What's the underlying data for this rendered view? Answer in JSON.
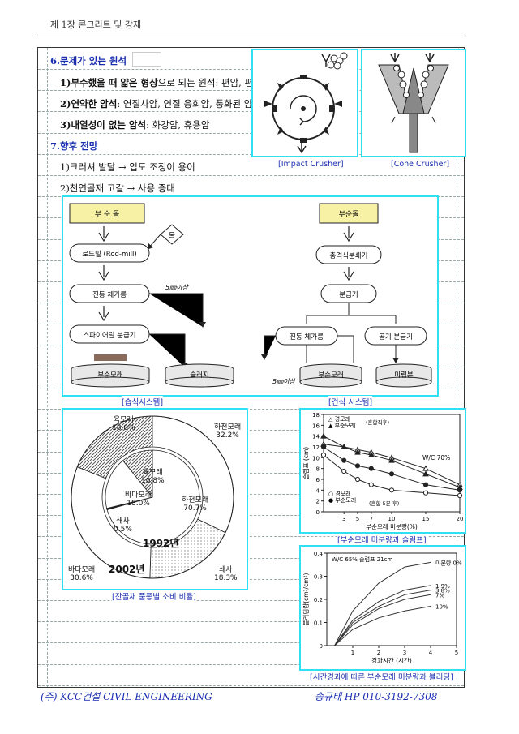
{
  "header": {
    "title": "제 1장 콘크리트 및 강재"
  },
  "section6": {
    "heading": "6.문제가 있는 원석",
    "items": [
      {
        "key": "1)부수했을 때 얇은 형상",
        "rest": "으로 되는 원석: 편암, 편마암"
      },
      {
        "key": "2)연약한 암석",
        "rest": ": 연질사암, 연질 응회암, 풍화된 암석"
      },
      {
        "key": "3)내열성이 없는 암석",
        "rest": ": 화강암, 휴용암"
      }
    ]
  },
  "section7": {
    "heading": "7.향후 전망",
    "items": [
      "1)크러셔 발달 → 입도 조정이 용이",
      "2)천연골재 고갈 → 사용 증대"
    ]
  },
  "crushers": {
    "impact_label": "[Impact Crusher]",
    "cone_label": "[Cone Crusher]"
  },
  "wet_system": {
    "top": "부 순 돌",
    "water": "물",
    "rodmill": "로드밀 (Rod-mill)",
    "screen": "진동 체가름",
    "note": "5㎜이상",
    "spiral": "스파이어럴 분급기",
    "product": "부순모래",
    "sludge": "슬러지",
    "caption": "[습식시스템]"
  },
  "dry_system": {
    "top": "부순돌",
    "impact": "충격식분쇄기",
    "classifier": "분급기",
    "screen": "진동 체가름",
    "air": "공기 분급기",
    "note": "5㎜이상",
    "product": "부순모래",
    "fines": "미립분",
    "caption": "[건식 시스템]"
  },
  "donut": {
    "caption": "[잔골재 품종별 소비 비율]",
    "year_inner": "1992년",
    "year_outer": "2002년",
    "outer_labels": [
      {
        "name": "육모래",
        "pct": "18.8%"
      },
      {
        "name": "하천모래",
        "pct": "32.2%"
      },
      {
        "name": "쇄사",
        "pct": "18.3%"
      },
      {
        "name": "바다모래",
        "pct": "30.6%"
      }
    ],
    "inner_labels": [
      {
        "name": "육모래",
        "pct": "10.8%"
      },
      {
        "name": "바다모래",
        "pct": "18.0%"
      },
      {
        "name": "하천모래",
        "pct": "70.7%"
      },
      {
        "name": "쇄사",
        "pct": "0.5%"
      }
    ]
  },
  "chart_data": [
    {
      "type": "line",
      "caption": "[부순모래 미분량과 슬럼프]",
      "xlabel": "부순모래 미분량(%)",
      "ylabel": "슬럼프 (cm)",
      "xlim": [
        0,
        20
      ],
      "ylim": [
        0,
        18
      ],
      "xticks": [
        3,
        5,
        7,
        10,
        15,
        20
      ],
      "yticks": [
        0,
        2,
        4,
        6,
        8,
        10,
        12,
        14,
        16,
        18
      ],
      "annotation": "W/C 70%",
      "legend_top": [
        "△ 경모래",
        "▲ 부순모래",
        "(혼합직후)"
      ],
      "legend_bottom": [
        "○ 경모래",
        "● 부순모래",
        "(혼합 5분 후)"
      ],
      "series": [
        {
          "marker": "open-triangle",
          "x": [
            0,
            3,
            5,
            7,
            10,
            15,
            20
          ],
          "y": [
            12.5,
            12,
            11.5,
            11,
            10,
            8,
            5
          ]
        },
        {
          "marker": "filled-triangle",
          "x": [
            0,
            3,
            5,
            7,
            10,
            15,
            20
          ],
          "y": [
            14,
            12,
            11,
            10.5,
            9.5,
            7,
            4.5
          ]
        },
        {
          "marker": "open-circle",
          "x": [
            0,
            3,
            5,
            7,
            10,
            15,
            20
          ],
          "y": [
            10.5,
            7.5,
            6,
            5,
            4,
            3.5,
            3
          ]
        },
        {
          "marker": "filled-circle",
          "x": [
            0,
            3,
            5,
            7,
            10,
            15,
            20
          ],
          "y": [
            12,
            9.5,
            8.5,
            8,
            7,
            5,
            4
          ]
        }
      ]
    },
    {
      "type": "line",
      "caption": "[시간경과에 따른 부순모래 미분량과 블리딩]",
      "xlabel": "경과시간 (시간)",
      "ylabel": "블리딩량(cm³/cm²)",
      "xlim": [
        0,
        5
      ],
      "ylim": [
        0,
        0.4
      ],
      "xticks": [
        1,
        2,
        3,
        4,
        5
      ],
      "yticks": [
        0,
        0.1,
        0.2,
        0.3,
        0.4
      ],
      "annotation": "W/C 65%  슬럼프 21cm",
      "series_label_title": "미분량 0%",
      "series": [
        {
          "name": "미분량 0%",
          "x": [
            0.3,
            1,
            2,
            3,
            4
          ],
          "y": [
            0,
            0.15,
            0.27,
            0.34,
            0.36
          ]
        },
        {
          "name": "1.9%",
          "x": [
            0.3,
            1,
            2,
            3,
            4
          ],
          "y": [
            0,
            0.11,
            0.19,
            0.24,
            0.26
          ]
        },
        {
          "name": "3.8%",
          "x": [
            0.3,
            1,
            2,
            3,
            4
          ],
          "y": [
            0,
            0.1,
            0.17,
            0.22,
            0.24
          ]
        },
        {
          "name": "7%",
          "x": [
            0.3,
            1,
            2,
            3,
            4
          ],
          "y": [
            0,
            0.09,
            0.16,
            0.2,
            0.22
          ]
        },
        {
          "name": "10%",
          "x": [
            0.3,
            1,
            2,
            3,
            4
          ],
          "y": [
            0,
            0.07,
            0.12,
            0.15,
            0.17
          ]
        }
      ]
    }
  ],
  "footer": {
    "left": "(주) KCC건설   CIVIL ENGINEERING",
    "right": "송규태  HP 010-3192-7308"
  }
}
